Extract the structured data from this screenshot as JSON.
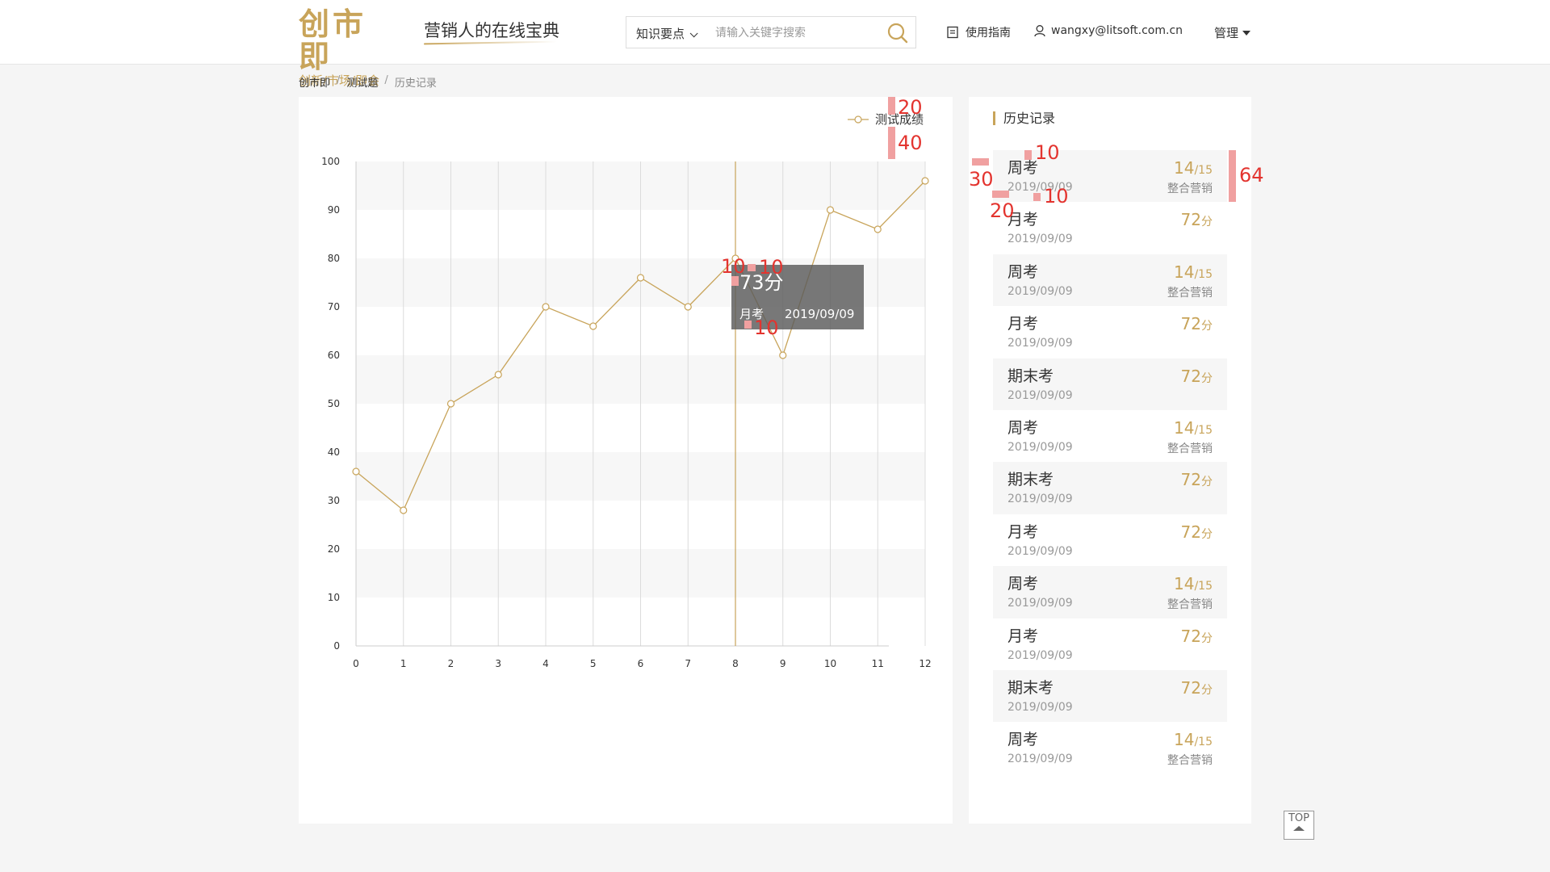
{
  "header": {
    "logo_main": "创市即",
    "logo_sub": "创新/市场/即会",
    "slogan": "营销人的在线宝典",
    "search_category": "知识要点",
    "search_placeholder": "请输入关键字搜索",
    "guide_label": "使用指南",
    "user_email": "wangxy@litsoft.com.cn",
    "manage_label": "管理"
  },
  "breadcrumb": [
    "创市即",
    "测试题",
    "历史记录"
  ],
  "chart": {
    "legend": "测试成绩",
    "tooltip_score": "73分",
    "tooltip_type": "月考",
    "tooltip_date": "2019/09/09"
  },
  "chart_data": {
    "type": "line",
    "x": [
      0,
      1,
      2,
      3,
      4,
      5,
      6,
      7,
      8,
      9,
      10,
      11,
      12
    ],
    "series": [
      {
        "name": "测试成绩",
        "values": [
          36,
          28,
          50,
          56,
          70,
          66,
          76,
          70,
          80,
          60,
          90,
          86,
          96
        ]
      }
    ],
    "x_ticks": [
      "0",
      "1",
      "2",
      "3",
      "4",
      "5",
      "6",
      "7",
      "8",
      "9",
      "10",
      "11",
      "12"
    ],
    "y_ticks": [
      "0",
      "10",
      "20",
      "30",
      "40",
      "50",
      "60",
      "70",
      "80",
      "90",
      "100"
    ],
    "ylim": [
      0,
      100
    ],
    "xlim": [
      0,
      12
    ],
    "grid": true,
    "highlight_x": 8,
    "color": "#c8a45a"
  },
  "history": {
    "title": "历史记录",
    "items": [
      {
        "name": "周考",
        "date": "2019/09/09",
        "score": "14",
        "score_suffix": "/15",
        "category": "整合营销"
      },
      {
        "name": "月考",
        "date": "2019/09/09",
        "score": "72",
        "score_suffix": "分",
        "category": ""
      },
      {
        "name": "周考",
        "date": "2019/09/09",
        "score": "14",
        "score_suffix": "/15",
        "category": "整合营销"
      },
      {
        "name": "月考",
        "date": "2019/09/09",
        "score": "72",
        "score_suffix": "分",
        "category": ""
      },
      {
        "name": "期末考",
        "date": "2019/09/09",
        "score": "72",
        "score_suffix": "分",
        "category": ""
      },
      {
        "name": "周考",
        "date": "2019/09/09",
        "score": "14",
        "score_suffix": "/15",
        "category": "整合营销"
      },
      {
        "name": "期末考",
        "date": "2019/09/09",
        "score": "72",
        "score_suffix": "分",
        "category": ""
      },
      {
        "name": "月考",
        "date": "2019/09/09",
        "score": "72",
        "score_suffix": "分",
        "category": ""
      },
      {
        "name": "周考",
        "date": "2019/09/09",
        "score": "14",
        "score_suffix": "/15",
        "category": "整合营销"
      },
      {
        "name": "月考",
        "date": "2019/09/09",
        "score": "72",
        "score_suffix": "分",
        "category": ""
      },
      {
        "name": "期末考",
        "date": "2019/09/09",
        "score": "72",
        "score_suffix": "分",
        "category": ""
      },
      {
        "name": "周考",
        "date": "2019/09/09",
        "score": "14",
        "score_suffix": "/15",
        "category": "整合营销"
      }
    ]
  },
  "top_button": "TOP",
  "annotations": {
    "a20_top": "20",
    "a40": "40",
    "a10_a": "10",
    "a30": "30",
    "a64": "64",
    "a20_b": "20",
    "a10_b": "10",
    "a10_tt1": "10",
    "a10_tt2": "10",
    "a10_tt3": "10"
  },
  "colors": {
    "accent": "#c8a45a",
    "annotation": "#e3342f"
  }
}
